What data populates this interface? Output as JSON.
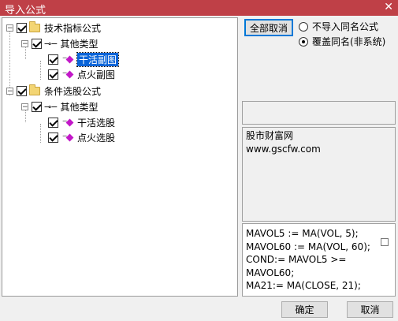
{
  "window": {
    "title": "导入公式",
    "close_glyph": "✕"
  },
  "tree": {
    "root1": {
      "label": "技术指标公式",
      "expander": "−",
      "checked": true
    },
    "root1_child": {
      "label": "其他类型",
      "expander": "−",
      "checked": true,
      "icon": "key-icon"
    },
    "root1_leaf1": {
      "label": "干活副图",
      "checked": true,
      "selected": true
    },
    "root1_leaf2": {
      "label": "点火副图",
      "checked": true
    },
    "root2": {
      "label": "条件选股公式",
      "expander": "−",
      "checked": true
    },
    "root2_child": {
      "label": "其他类型",
      "expander": "−",
      "checked": true,
      "icon": "key-icon"
    },
    "root2_leaf1": {
      "label": "干活选股",
      "checked": true
    },
    "root2_leaf2": {
      "label": "点火选股",
      "checked": true
    }
  },
  "controls": {
    "cancel_all_label": "全部取消",
    "radio_no_import": "不导入同名公式",
    "radio_overwrite": "覆盖同名(非系统)",
    "overwrite_selected": true
  },
  "info": {
    "line1": "股市财富网",
    "line2": "www.gscfw.com"
  },
  "code": {
    "text": "MAVOL5 := MA(VOL, 5);\nMAVOL60 := MA(VOL, 60);\nCOND:= MAVOL5 >=\nMAVOL60;\nMA21:= MA(CLOSE, 21);"
  },
  "buttons": {
    "ok_label": "确定",
    "cancel_label": "取消"
  },
  "colors": {
    "titlebar": "#bf4047",
    "selection": "#0a64d8",
    "leaf_icon": "#c218c8",
    "folder": "#f3d574"
  }
}
